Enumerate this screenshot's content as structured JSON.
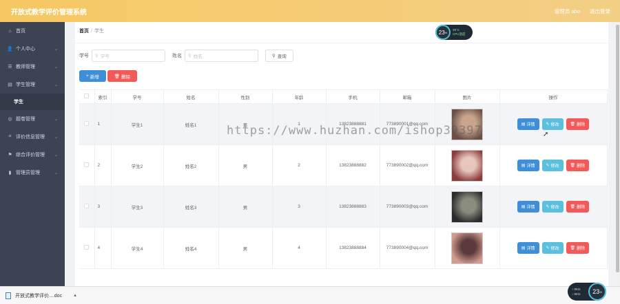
{
  "header": {
    "title": "开放式教学评价管理系统",
    "admin_label": "管理员 abo",
    "logout_label": "退出登录"
  },
  "sidebar": {
    "items": [
      {
        "label": "首页",
        "icon": "home-icon",
        "glyph": "⌂",
        "has_arrow": false
      },
      {
        "label": "个人中心",
        "icon": "user-icon",
        "glyph": "👤",
        "has_arrow": true
      },
      {
        "label": "教师管理",
        "icon": "list-icon",
        "glyph": "☰",
        "has_arrow": true
      },
      {
        "label": "学生管理",
        "icon": "document-icon",
        "glyph": "▤",
        "has_arrow": true
      }
    ],
    "sub_item": "学生",
    "items2": [
      {
        "label": "题卷管理",
        "icon": "compass-icon",
        "glyph": "◎"
      },
      {
        "label": "评价信息管理",
        "icon": "scan-icon",
        "glyph": "⌗"
      },
      {
        "label": "综合评价管理",
        "icon": "flag-icon",
        "glyph": "⚑"
      },
      {
        "label": "管理员管理",
        "icon": "chart-icon",
        "glyph": "▮"
      }
    ]
  },
  "breadcrumb": {
    "home": "首页",
    "separator": "/",
    "current": "学生"
  },
  "search": {
    "student_no_label": "学号",
    "student_no_placeholder": "学号",
    "name_label": "姓名",
    "name_placeholder": "姓名",
    "query_label": "查询"
  },
  "actions": {
    "add_label": "新增",
    "delete_label": "删除"
  },
  "table": {
    "headers": [
      "索引",
      "学号",
      "姓名",
      "性别",
      "年龄",
      "手机",
      "邮箱",
      "图片",
      "操作"
    ],
    "rows": [
      {
        "index": "1",
        "student_no": "学生1",
        "name": "姓名1",
        "gender": "男",
        "age": "1",
        "phone": "13823888881",
        "email": "773890001@qq.com"
      },
      {
        "index": "2",
        "student_no": "学生2",
        "name": "姓名2",
        "gender": "男",
        "age": "2",
        "phone": "13823888882",
        "email": "773890002@qq.com"
      },
      {
        "index": "3",
        "student_no": "学生3",
        "name": "姓名3",
        "gender": "男",
        "age": "3",
        "phone": "13823888883",
        "email": "773890003@qq.com"
      },
      {
        "index": "4",
        "student_no": "学生4",
        "name": "姓名4",
        "gender": "男",
        "age": "4",
        "phone": "13823888884",
        "email": "773890004@qq.com"
      }
    ],
    "op_detail": "详情",
    "op_edit": "修改",
    "op_delete": "删除"
  },
  "watermark": "https://www.huzhan.com/ishop39397",
  "gauge_top": {
    "value": "23",
    "unit": "%",
    "temp": "39°C",
    "cpu_label": "CPU温度"
  },
  "gauge_bottom": {
    "value": "23",
    "unit": "%",
    "up": "0K/s",
    "down": "0K/s"
  },
  "download": {
    "filename": "开放式教学评价....doc"
  },
  "colors": {
    "header": "#f5c56a",
    "sidebar": "#3c4454",
    "primary": "#3f8fd8",
    "danger": "#f25a5a",
    "info": "#5bc0de"
  }
}
